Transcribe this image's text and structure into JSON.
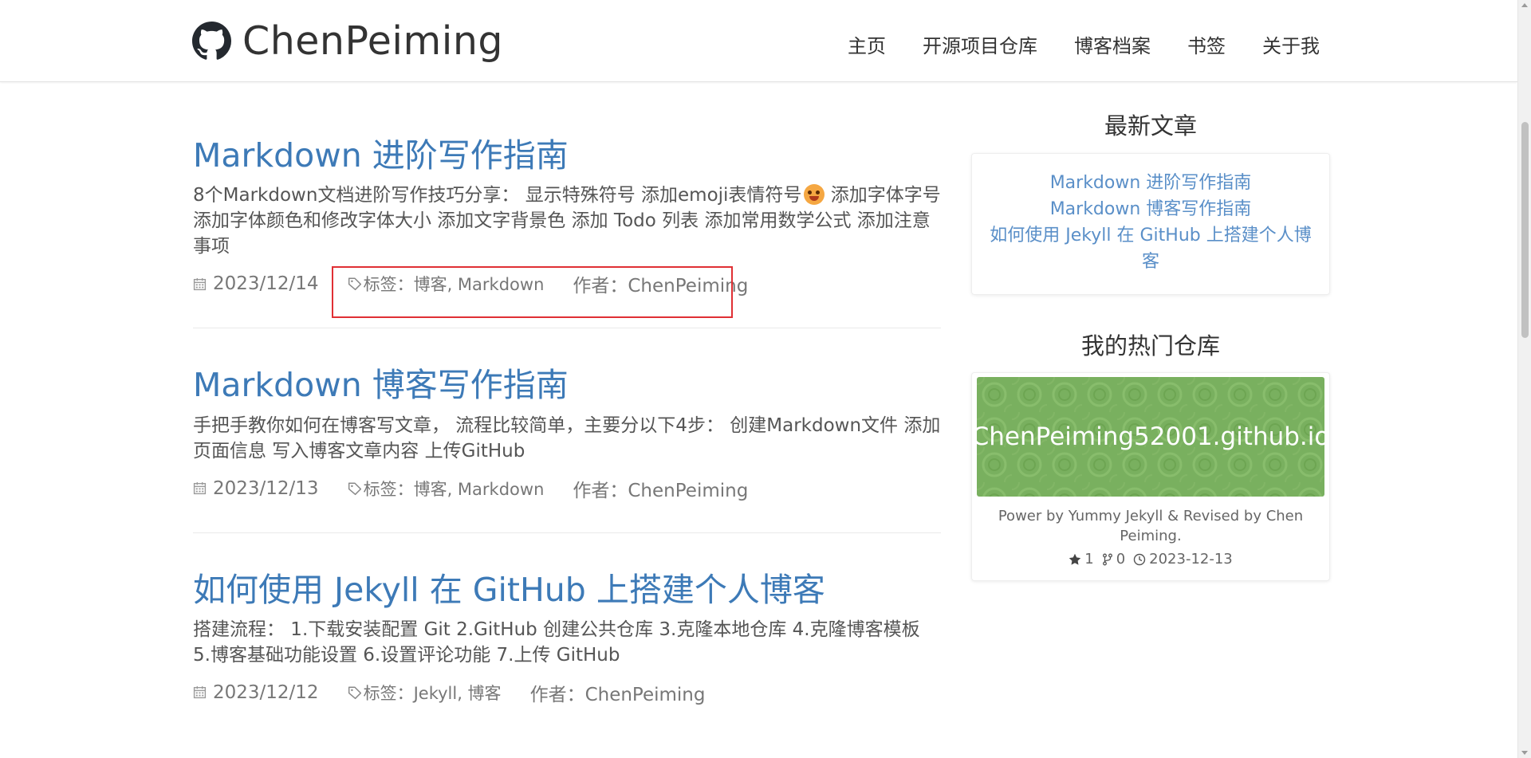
{
  "header": {
    "brand": "ChenPeiming",
    "logo_icon": "github-octocat-icon",
    "nav": [
      {
        "label": "主页"
      },
      {
        "label": "开源项目仓库"
      },
      {
        "label": "博客档案"
      },
      {
        "label": "书签"
      },
      {
        "label": "关于我"
      }
    ]
  },
  "posts": [
    {
      "title": "Markdown 进阶写作指南",
      "excerpt": "8个Markdown文档进阶写作技巧分享： 显示特殊符号 添加emoji表情符号",
      "excerpt_rest": " 添加字体字号 添加字体颜色和修改字体大小 添加文字背景色 添加 Todo 列表 添加常用数学公式 添加注意事项",
      "date": "2023/12/14",
      "tags_label": "标签：",
      "tags": "博客, Markdown",
      "author": "作者：ChenPeiming"
    },
    {
      "title": "Markdown 博客写作指南",
      "excerpt": "手把手教你如何在博客写文章， 流程比较简单，主要分以下4步： 创建Markdown文件 添加页面信息 写入博客文章内容 上传GitHub",
      "date": "2023/12/13",
      "tags_label": "标签：",
      "tags": "博客, Markdown",
      "author": "作者：ChenPeiming"
    },
    {
      "title": "如何使用 Jekyll 在 GitHub 上搭建个人博客",
      "excerpt": "搭建流程： 1.下载安装配置 Git 2.GitHub 创建公共仓库 3.克隆本地仓库 4.克隆博客模板 5.博客基础功能设置 6.设置评论功能 7.上传 GitHub",
      "date": "2023/12/12",
      "tags_label": "标签：",
      "tags": "Jekyll, 博客",
      "author": "作者：ChenPeiming"
    }
  ],
  "sidebar": {
    "latest_heading": "最新文章",
    "latest": [
      {
        "label": "Markdown 进阶写作指南"
      },
      {
        "label": "Markdown 博客写作指南"
      },
      {
        "label": "如何使用 Jekyll 在 GitHub 上搭建个人博客"
      }
    ],
    "repos_heading": "我的热门仓库",
    "repo": {
      "name": "ChenPeiming52001.github.io",
      "description": "Power by Yummy Jekyll & Revised by Chen Peiming.",
      "stars": "1",
      "forks": "0",
      "updated": "2023-12-13",
      "banner_color": "#79b05f"
    }
  },
  "colors": {
    "link": "#3d7ab7",
    "sidebar_link": "#5a8fc8",
    "highlight_box": "#e03034"
  }
}
